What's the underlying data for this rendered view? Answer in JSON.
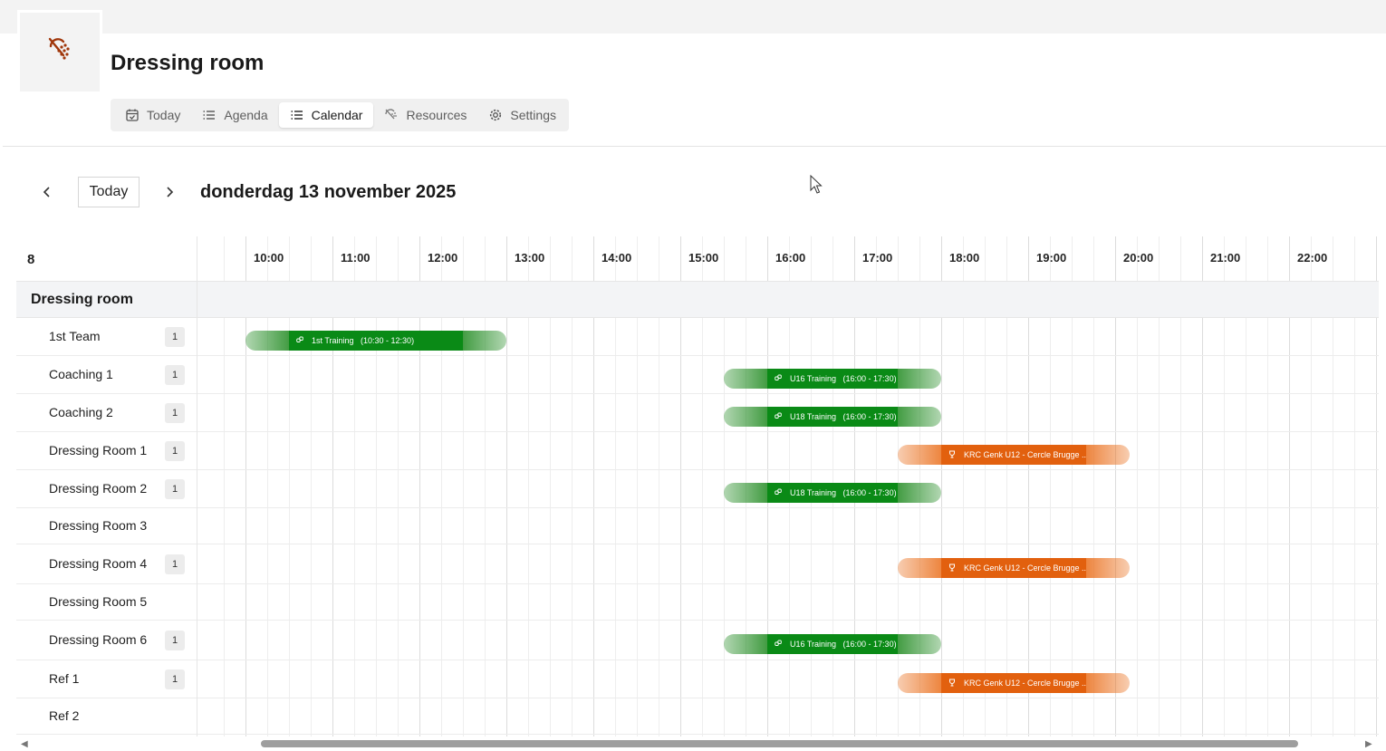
{
  "header": {
    "logo_icon": "shower-off-icon",
    "title": "Dressing room",
    "tabs": [
      {
        "label": "Today",
        "icon": "calendar-check-icon",
        "active": false
      },
      {
        "label": "Agenda",
        "icon": "list-icon",
        "active": false
      },
      {
        "label": "Calendar",
        "icon": "list-icon",
        "active": true
      },
      {
        "label": "Resources",
        "icon": "shower-icon",
        "active": false
      },
      {
        "label": "Settings",
        "icon": "gear-icon",
        "active": false
      }
    ]
  },
  "toolbar": {
    "prev_icon": "chevron-left-icon",
    "today_label": "Today",
    "next_icon": "chevron-right-icon",
    "date_title": "donderdag 13 november 2025"
  },
  "scheduler": {
    "corner_label": "8",
    "hours": [
      "10:00",
      "11:00",
      "12:00",
      "13:00",
      "14:00",
      "15:00",
      "16:00",
      "17:00",
      "18:00",
      "19:00",
      "20:00",
      "21:00",
      "22:00"
    ],
    "group_label": "Dressing room",
    "resources": [
      {
        "name": "1st Team",
        "count": "1"
      },
      {
        "name": "Coaching 1",
        "count": "1"
      },
      {
        "name": "Coaching 2",
        "count": "1"
      },
      {
        "name": "Dressing Room 1",
        "count": "1"
      },
      {
        "name": "Dressing Room 2",
        "count": "1"
      },
      {
        "name": "Dressing Room 3",
        "count": ""
      },
      {
        "name": "Dressing Room 4",
        "count": "1"
      },
      {
        "name": "Dressing Room 5",
        "count": ""
      },
      {
        "name": "Dressing Room 6",
        "count": "1"
      },
      {
        "name": "Ref 1",
        "count": "1"
      },
      {
        "name": "Ref 2",
        "count": ""
      }
    ],
    "events": [
      {
        "row": 0,
        "type": "training",
        "color": "#0a8a16",
        "icon": "link-icon",
        "label": "1st Training   (10:30 - 12:30)",
        "start": 10.5,
        "end": 12.5,
        "buffer_before": 0.5,
        "buffer_after": 0.5
      },
      {
        "row": 1,
        "type": "training",
        "color": "#0a8a16",
        "icon": "link-icon",
        "label": "U16 Training   (16:00 - 17:30)",
        "start": 16.0,
        "end": 17.5,
        "buffer_before": 0.5,
        "buffer_after": 0.5
      },
      {
        "row": 2,
        "type": "training",
        "color": "#0a8a16",
        "icon": "link-icon",
        "label": "U18 Training   (16:00 - 17:30)",
        "start": 16.0,
        "end": 17.5,
        "buffer_before": 0.5,
        "buffer_after": 0.5
      },
      {
        "row": 3,
        "type": "match",
        "color": "#e2600e",
        "icon": "trophy-icon",
        "label": "KRC Genk U12 - Cercle Brugge ...",
        "start": 18.0,
        "end": 19.67,
        "buffer_before": 0.5,
        "buffer_after": 0.5
      },
      {
        "row": 4,
        "type": "training",
        "color": "#0a8a16",
        "icon": "link-icon",
        "label": "U18 Training   (16:00 - 17:30)",
        "start": 16.0,
        "end": 17.5,
        "buffer_before": 0.5,
        "buffer_after": 0.5
      },
      {
        "row": 6,
        "type": "match",
        "color": "#e2600e",
        "icon": "trophy-icon",
        "label": "KRC Genk U12 - Cercle Brugge ...",
        "start": 18.0,
        "end": 19.67,
        "buffer_before": 0.5,
        "buffer_after": 0.5
      },
      {
        "row": 8,
        "type": "training",
        "color": "#0a8a16",
        "icon": "link-icon",
        "label": "U16 Training   (16:00 - 17:30)",
        "start": 16.0,
        "end": 17.5,
        "buffer_before": 0.5,
        "buffer_after": 0.5
      },
      {
        "row": 9,
        "type": "match",
        "color": "#e2600e",
        "icon": "trophy-icon",
        "label": "KRC Genk U12 - Cercle Brugge ...",
        "start": 18.0,
        "end": 19.67,
        "buffer_before": 0.5,
        "buffer_after": 0.5
      }
    ]
  }
}
